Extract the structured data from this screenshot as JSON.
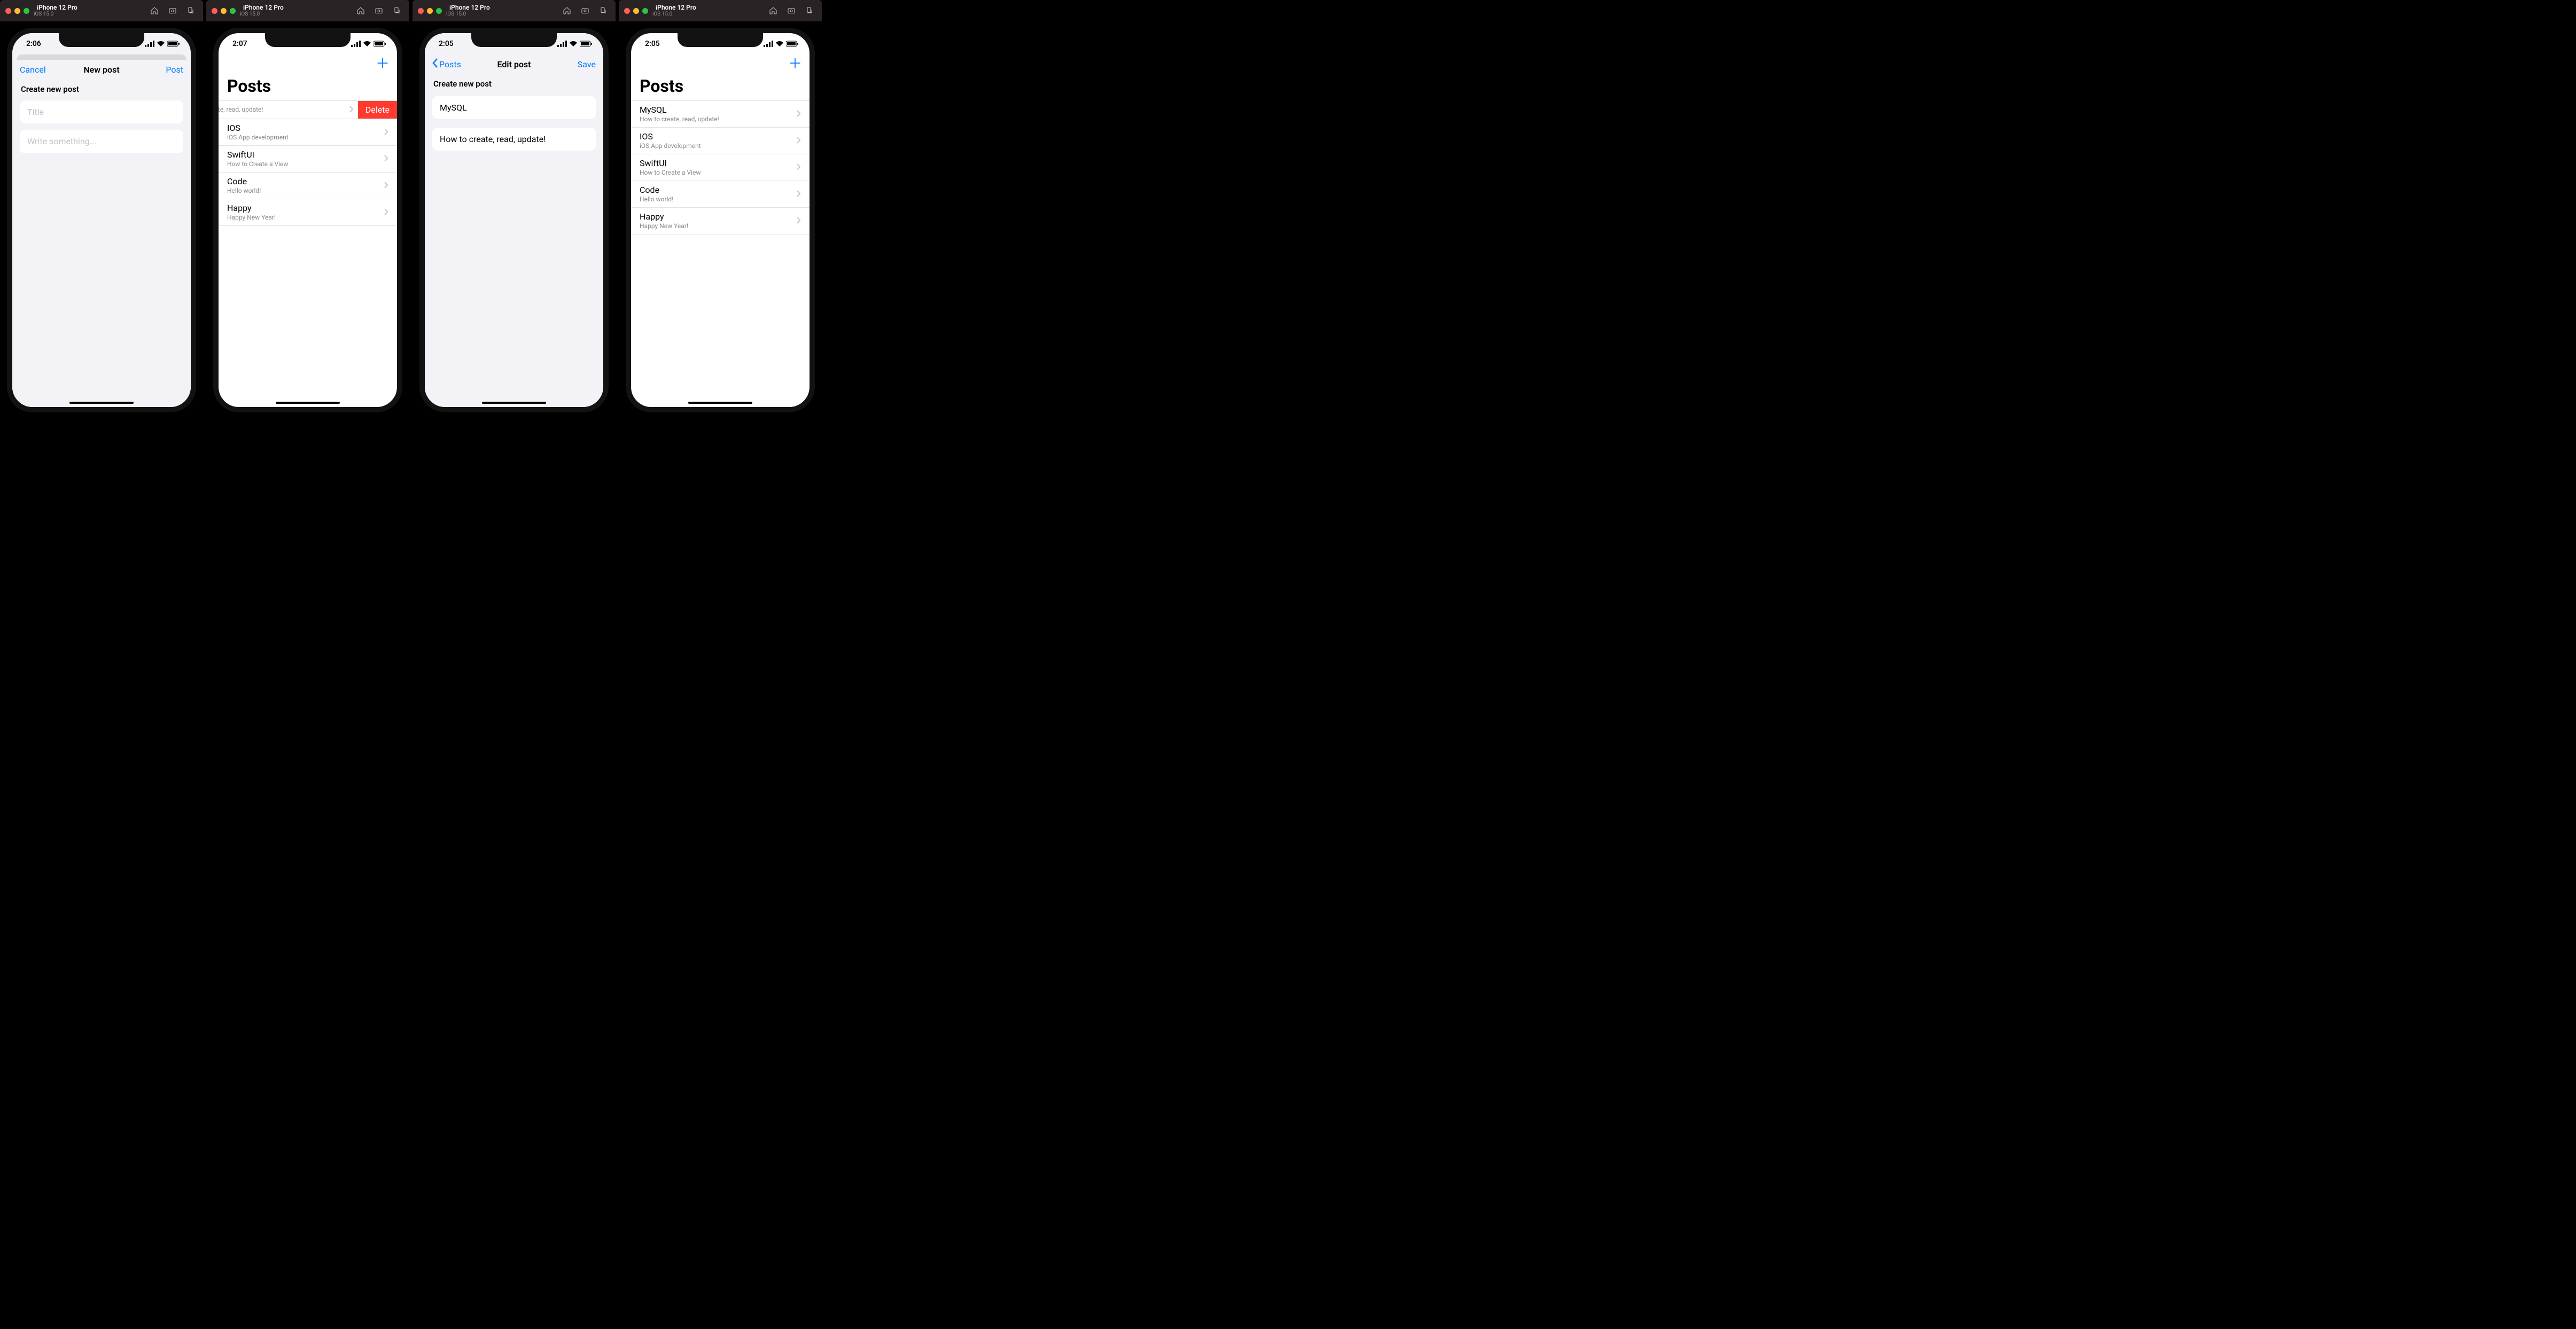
{
  "simulator": {
    "device": "iPhone 12 Pro",
    "os": "iOS 15.0"
  },
  "accent": "#007aff",
  "delete_color": "#ff3b30",
  "screens": [
    {
      "time": "2:06",
      "nav": {
        "left": "Cancel",
        "title": "New post",
        "right": "Post"
      },
      "section_header": "Create new post",
      "title_placeholder": "Title",
      "body_placeholder": "Write something..."
    },
    {
      "time": "2:07",
      "large_title": "Posts",
      "swiped_row": {
        "subtitle_fragment": "eate, read, update!",
        "action": "Delete"
      },
      "rows": [
        {
          "title": "IOS",
          "subtitle": "iOS App development"
        },
        {
          "title": "SwiftUI",
          "subtitle": "How to Create a View"
        },
        {
          "title": "Code",
          "subtitle": "Hello world!"
        },
        {
          "title": "Happy",
          "subtitle": "Happy New Year!"
        }
      ]
    },
    {
      "time": "2:05",
      "nav": {
        "back": "Posts",
        "title": "Edit post",
        "right": "Save"
      },
      "section_header": "Create new post",
      "title_value": "MySQL",
      "body_value": "How to create, read, update!"
    },
    {
      "time": "2:05",
      "large_title": "Posts",
      "rows": [
        {
          "title": "MySQL",
          "subtitle": "How to create, read, update!"
        },
        {
          "title": "IOS",
          "subtitle": "iOS App development"
        },
        {
          "title": "SwiftUI",
          "subtitle": "How to Create a View"
        },
        {
          "title": "Code",
          "subtitle": "Hello world!"
        },
        {
          "title": "Happy",
          "subtitle": "Happy New Year!"
        }
      ]
    }
  ]
}
